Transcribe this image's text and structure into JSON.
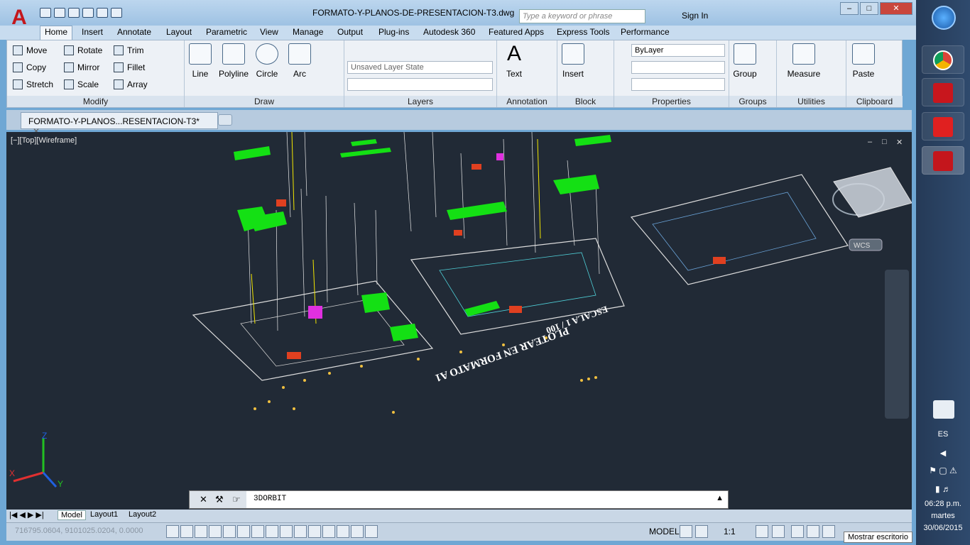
{
  "window": {
    "title": "FORMATO-Y-PLANOS-DE-PRESENTACION-T3.dwg",
    "search_placeholder": "Type a keyword or phrase",
    "sign_in": "Sign In"
  },
  "ribbon_tabs": [
    "Home",
    "Insert",
    "Annotate",
    "Layout",
    "Parametric",
    "View",
    "Manage",
    "Output",
    "Plug-ins",
    "Autodesk 360",
    "Featured Apps",
    "Express Tools",
    "Performance"
  ],
  "modify": {
    "label": "Modify",
    "items": [
      "Move",
      "Rotate",
      "Trim",
      "Copy",
      "Mirror",
      "Fillet",
      "Stretch",
      "Scale",
      "Array"
    ]
  },
  "draw": {
    "label": "Draw",
    "items": [
      "Line",
      "Polyline",
      "Circle",
      "Arc"
    ]
  },
  "layers": {
    "label": "Layers",
    "layer_state": "Unsaved Layer State"
  },
  "annotation": {
    "label": "Annotation",
    "text": "Text"
  },
  "block": {
    "label": "Block",
    "insert": "Insert"
  },
  "properties": {
    "label": "Properties",
    "bylayer": "ByLayer"
  },
  "groups": {
    "label": "Groups",
    "group": "Group"
  },
  "utilities": {
    "label": "Utilities",
    "measure": "Measure"
  },
  "clipboard": {
    "label": "Clipboard",
    "paste": "Paste"
  },
  "doc_tab": "FORMATO-Y-PLANOS...RESENTACION-T3*",
  "viewport": {
    "label": "[−][Top][Wireframe]",
    "wcs": "WCS",
    "plot_text_1": "PLOTEAR EN FORMATO A1",
    "plot_text_2": "ESCALA 1 / 100",
    "axis_z": "Z",
    "axis_x": "X",
    "axis_y": "Y"
  },
  "command": {
    "value": "3DORBIT"
  },
  "layout_tabs": [
    "Model",
    "Layout1",
    "Layout2"
  ],
  "status": {
    "coords": "716795.0604, 9101025.0204, 0.0000",
    "model": "MODEL",
    "scale": "1:1",
    "tooltip": "Mostrar escritorio"
  },
  "taskbar": {
    "lang": "ES",
    "time": "06:28 p.m.",
    "day": "martes",
    "date": "30/06/2015"
  }
}
